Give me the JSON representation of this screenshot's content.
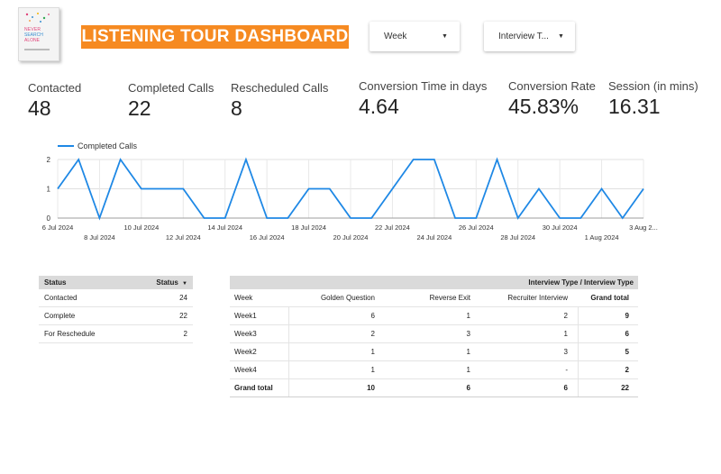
{
  "header": {
    "title": "LISTENING TOUR DASHBOARD",
    "book_cover": {
      "line1": "NEVER",
      "line2": "SEARCH",
      "line3": "ALONE"
    },
    "brand_color": "#f68a21"
  },
  "filters": {
    "week": {
      "label": "Week"
    },
    "interview_type": {
      "label": "Interview T..."
    }
  },
  "kpis": [
    {
      "label": "Contacted",
      "value": "48"
    },
    {
      "label": "Completed Calls",
      "value": "22"
    },
    {
      "label": "Rescheduled Calls",
      "value": "8"
    },
    {
      "label": "Conversion Time in days",
      "value": "4.64"
    },
    {
      "label": "Conversion Rate",
      "value": "45.83%"
    },
    {
      "label": "Session (in mins)",
      "value": "16.31"
    }
  ],
  "chart_data": {
    "type": "line",
    "series": [
      {
        "name": "Completed Calls",
        "color": "#1e88e5",
        "values": [
          1,
          2,
          0,
          2,
          1,
          1,
          1,
          0,
          0,
          2,
          0,
          0,
          1,
          1,
          0,
          0,
          1,
          2,
          2,
          0,
          0,
          2,
          0,
          1,
          0,
          0,
          1,
          0,
          1
        ]
      }
    ],
    "x": [
      "6 Jul 2024",
      "7 Jul 2024",
      "8 Jul 2024",
      "9 Jul 2024",
      "10 Jul 2024",
      "11 Jul 2024",
      "12 Jul 2024",
      "13 Jul 2024",
      "14 Jul 2024",
      "15 Jul 2024",
      "16 Jul 2024",
      "17 Jul 2024",
      "18 Jul 2024",
      "19 Jul 2024",
      "20 Jul 2024",
      "21 Jul 2024",
      "22 Jul 2024",
      "23 Jul 2024",
      "24 Jul 2024",
      "25 Jul 2024",
      "26 Jul 2024",
      "27 Jul 2024",
      "28 Jul 2024",
      "29 Jul 2024",
      "30 Jul 2024",
      "31 Jul 2024",
      "1 Aug 2024",
      "2 Aug 2024",
      "3 Aug 2024"
    ],
    "tick_labels_upper": [
      {
        "i": 0,
        "text": "6 Jul 2024"
      },
      {
        "i": 4,
        "text": "10 Jul 2024"
      },
      {
        "i": 8,
        "text": "14 Jul 2024"
      },
      {
        "i": 12,
        "text": "18 Jul 2024"
      },
      {
        "i": 16,
        "text": "22 Jul 2024"
      },
      {
        "i": 20,
        "text": "26 Jul 2024"
      },
      {
        "i": 24,
        "text": "30 Jul 2024"
      },
      {
        "i": 28,
        "text": "3 Aug 2..."
      }
    ],
    "tick_labels_lower": [
      {
        "i": 2,
        "text": "8 Jul 2024"
      },
      {
        "i": 6,
        "text": "12 Jul 2024"
      },
      {
        "i": 10,
        "text": "16 Jul 2024"
      },
      {
        "i": 14,
        "text": "20 Jul 2024"
      },
      {
        "i": 18,
        "text": "24 Jul 2024"
      },
      {
        "i": 22,
        "text": "28 Jul 2024"
      },
      {
        "i": 26,
        "text": "1 Aug 2024"
      }
    ],
    "y_ticks": [
      "0",
      "1",
      "2"
    ],
    "ylim": [
      0,
      2
    ],
    "legend": "top-left",
    "grid": true
  },
  "status_table": {
    "headers": [
      "Status",
      "Status"
    ],
    "sort_icon": "sort-down-icon",
    "rows": [
      {
        "status": "Contacted",
        "count": "24"
      },
      {
        "status": "Complete",
        "count": "22"
      },
      {
        "status": "For Reschedule",
        "count": "2"
      }
    ]
  },
  "pivot_table": {
    "title": "Interview Type / Interview Type",
    "headers": [
      "Week",
      "Golden Question",
      "Reverse Exit",
      "Recruiter Interview",
      "Grand total"
    ],
    "rows": [
      {
        "week": "Week1",
        "golden": "6",
        "reverse": "1",
        "recruiter": "2",
        "total": "9"
      },
      {
        "week": "Week3",
        "golden": "2",
        "reverse": "3",
        "recruiter": "1",
        "total": "6"
      },
      {
        "week": "Week2",
        "golden": "1",
        "reverse": "1",
        "recruiter": "3",
        "total": "5"
      },
      {
        "week": "Week4",
        "golden": "1",
        "reverse": "1",
        "recruiter": "-",
        "total": "2"
      }
    ],
    "grand_total": {
      "label": "Grand total",
      "golden": "10",
      "reverse": "6",
      "recruiter": "6",
      "total": "22"
    }
  }
}
